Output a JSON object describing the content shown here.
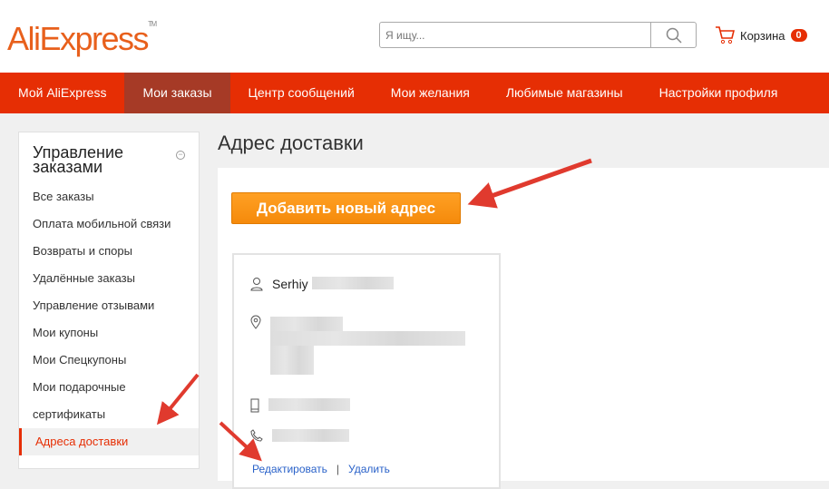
{
  "header": {
    "logo": "AliExpress",
    "search_placeholder": "Я ищу...",
    "cart_label": "Корзина",
    "cart_count": "0"
  },
  "nav": [
    "Мой AliExpress",
    "Мои заказы",
    "Центр сообщений",
    "Мои желания",
    "Любимые магазины",
    "Настройки профиля"
  ],
  "sidebar": {
    "title": "Управление заказами",
    "collapse": "−",
    "items": [
      "Все заказы",
      "Оплата мобильной связи",
      "Возвраты и споры",
      "Удалённые заказы",
      "Управление отзывами",
      "Мои купоны",
      "Мои Спецкупоны",
      "Мои подарочные",
      "сертификаты",
      "Адреса доставки"
    ]
  },
  "main": {
    "title": "Адрес доставки",
    "add_button": "Добавить новый адрес",
    "card": {
      "name": "Serhiy",
      "edit": "Редактировать",
      "separator": "|",
      "delete": "Удалить"
    }
  },
  "colors": {
    "brand": "#e62e04",
    "button": "#f58a0b"
  }
}
